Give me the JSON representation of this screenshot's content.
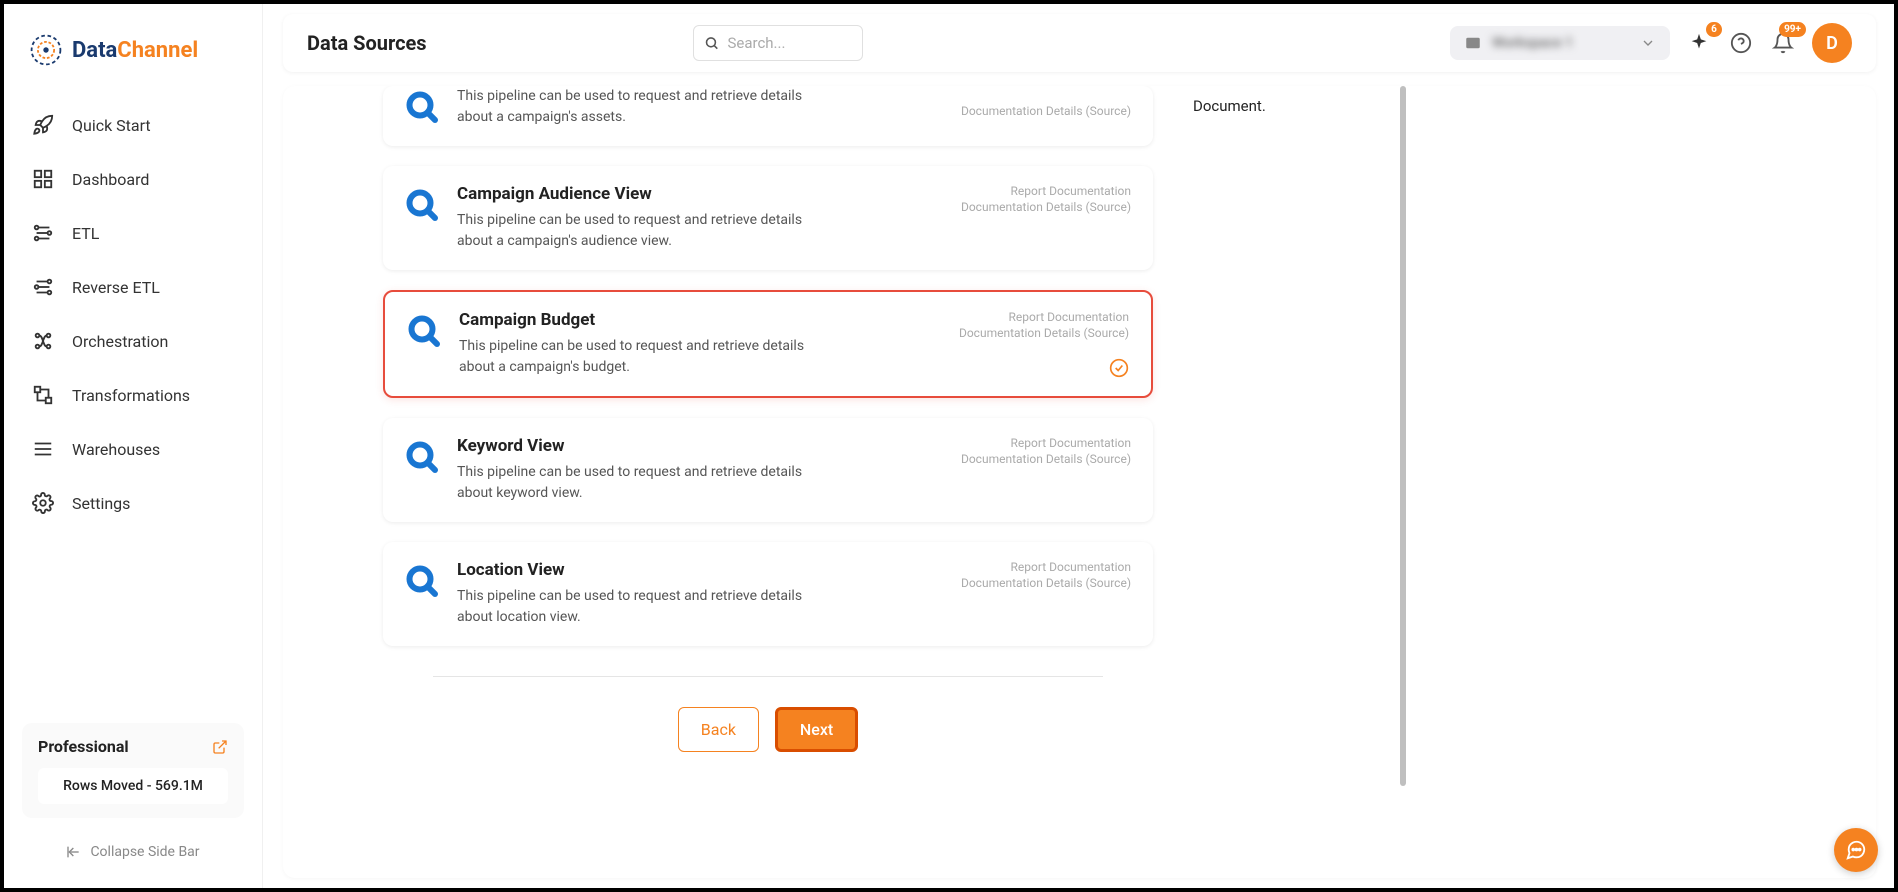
{
  "logo": {
    "part1": "Data",
    "part2": "Channel"
  },
  "pageTitle": "Data Sources",
  "search": {
    "placeholder": "Search..."
  },
  "workspace": {
    "label": "Workspace 1"
  },
  "topbar": {
    "sparkle_badge": "6",
    "bell_badge": "99+"
  },
  "avatar": {
    "initial": "D"
  },
  "sidebar": {
    "items": [
      {
        "label": "Quick Start"
      },
      {
        "label": "Dashboard"
      },
      {
        "label": "ETL"
      },
      {
        "label": "Reverse ETL"
      },
      {
        "label": "Orchestration"
      },
      {
        "label": "Transformations"
      },
      {
        "label": "Warehouses"
      },
      {
        "label": "Settings"
      }
    ],
    "plan": {
      "name": "Professional",
      "rows": "Rows Moved - 569.1M"
    },
    "collapse": "Collapse Side Bar"
  },
  "right": {
    "doc": "Document."
  },
  "cards": [
    {
      "title": "",
      "desc": "This pipeline can be used to request and retrieve details about a campaign's assets.",
      "link1": "",
      "link2": "Documentation Details (Source)"
    },
    {
      "title": "Campaign Audience View",
      "desc": "This pipeline can be used to request and retrieve details about a campaign's audience view.",
      "link1": "Report Documentation",
      "link2": "Documentation Details (Source)"
    },
    {
      "title": "Campaign Budget",
      "desc": "This pipeline can be used to request and retrieve details about a campaign's budget.",
      "link1": "Report Documentation",
      "link2": "Documentation Details (Source)"
    },
    {
      "title": "Keyword View",
      "desc": "This pipeline can be used to request and retrieve details about keyword view.",
      "link1": "Report Documentation",
      "link2": "Documentation Details (Source)"
    },
    {
      "title": "Location View",
      "desc": "This pipeline can be used to request and retrieve details about location view.",
      "link1": "Report Documentation",
      "link2": "Documentation Details (Source)"
    }
  ],
  "buttons": {
    "back": "Back",
    "next": "Next"
  }
}
